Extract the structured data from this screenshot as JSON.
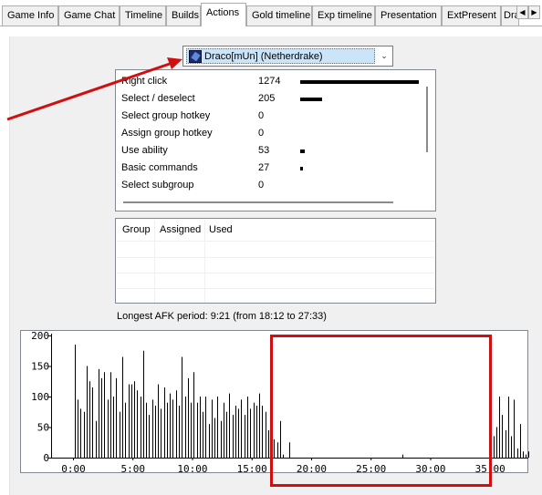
{
  "tabs": [
    {
      "label": "Game Info"
    },
    {
      "label": "Game Chat"
    },
    {
      "label": "Timeline"
    },
    {
      "label": "Builds"
    },
    {
      "label": "Actions"
    },
    {
      "label": "Gold timeline"
    },
    {
      "label": "Exp timeline"
    },
    {
      "label": "Presentation"
    },
    {
      "label": "ExtPresent"
    },
    {
      "label": "Dra"
    }
  ],
  "active_tab": "Actions",
  "player_select": {
    "value": "Draco[mUn] (Netherdrake)",
    "icon": "netherdrake-hero-icon"
  },
  "actions": [
    {
      "name": "Right click",
      "count": "1274"
    },
    {
      "name": "Select / deselect",
      "count": "205"
    },
    {
      "name": "Select group hotkey",
      "count": "0"
    },
    {
      "name": "Assign group hotkey",
      "count": "0"
    },
    {
      "name": "Use ability",
      "count": "53"
    },
    {
      "name": "Basic commands",
      "count": "27"
    },
    {
      "name": "Select subgroup",
      "count": "0"
    }
  ],
  "groups_table": {
    "columns": [
      "Group",
      "Assigned",
      "Used"
    ],
    "rows": []
  },
  "afk_text": "Longest AFK period: 9:21 (from 18:12 to 27:33)",
  "chart_data": {
    "type": "bar",
    "y_ticks": [
      "200",
      "150",
      "100",
      "50",
      "0"
    ],
    "x_ticks": [
      "0:00",
      "5:00",
      "10:00",
      "15:00",
      "20:00",
      "25:00",
      "30:00",
      "35:00"
    ],
    "ylim": [
      0,
      200
    ],
    "xlim_minutes": [
      -1.8,
      38.2
    ],
    "bar_color": "#000000",
    "highlight_color": "#d01010",
    "arrow_color": "#d01010",
    "values": [
      [
        0.1,
        185
      ],
      [
        0.35,
        95
      ],
      [
        0.6,
        80
      ],
      [
        0.85,
        75
      ],
      [
        1.1,
        150
      ],
      [
        1.35,
        125
      ],
      [
        1.6,
        115
      ],
      [
        1.85,
        60
      ],
      [
        2.1,
        145
      ],
      [
        2.35,
        130
      ],
      [
        2.6,
        140
      ],
      [
        2.85,
        95
      ],
      [
        3.1,
        140
      ],
      [
        3.35,
        100
      ],
      [
        3.6,
        130
      ],
      [
        3.85,
        75
      ],
      [
        4.1,
        165
      ],
      [
        4.35,
        90
      ],
      [
        4.6,
        120
      ],
      [
        4.85,
        120
      ],
      [
        5.1,
        125
      ],
      [
        5.35,
        110
      ],
      [
        5.6,
        100
      ],
      [
        5.85,
        175
      ],
      [
        6.1,
        90
      ],
      [
        6.35,
        70
      ],
      [
        6.6,
        95
      ],
      [
        6.85,
        85
      ],
      [
        7.1,
        120
      ],
      [
        7.35,
        80
      ],
      [
        7.6,
        115
      ],
      [
        7.85,
        90
      ],
      [
        8.1,
        105
      ],
      [
        8.35,
        95
      ],
      [
        8.6,
        110
      ],
      [
        8.85,
        85
      ],
      [
        9.1,
        165
      ],
      [
        9.35,
        100
      ],
      [
        9.6,
        130
      ],
      [
        9.85,
        90
      ],
      [
        10.1,
        140
      ],
      [
        10.35,
        90
      ],
      [
        10.6,
        100
      ],
      [
        10.85,
        75
      ],
      [
        11.1,
        100
      ],
      [
        11.35,
        55
      ],
      [
        11.6,
        95
      ],
      [
        11.85,
        65
      ],
      [
        12.1,
        100
      ],
      [
        12.35,
        60
      ],
      [
        12.6,
        90
      ],
      [
        12.85,
        75
      ],
      [
        13.1,
        105
      ],
      [
        13.35,
        70
      ],
      [
        13.6,
        85
      ],
      [
        13.85,
        80
      ],
      [
        14.1,
        95
      ],
      [
        14.35,
        70
      ],
      [
        14.6,
        100
      ],
      [
        14.85,
        80
      ],
      [
        15.1,
        90
      ],
      [
        15.35,
        85
      ],
      [
        15.6,
        105
      ],
      [
        15.85,
        85
      ],
      [
        16.1,
        75
      ],
      [
        16.35,
        45
      ],
      [
        16.6,
        55
      ],
      [
        16.85,
        30
      ],
      [
        17.1,
        25
      ],
      [
        17.35,
        60
      ],
      [
        17.6,
        5
      ],
      [
        18.1,
        25
      ],
      [
        27.6,
        5
      ],
      [
        35.0,
        25
      ],
      [
        35.25,
        35
      ],
      [
        35.5,
        50
      ],
      [
        35.75,
        100
      ],
      [
        36.0,
        70
      ],
      [
        36.25,
        45
      ],
      [
        36.5,
        100
      ],
      [
        36.75,
        35
      ],
      [
        37.0,
        95
      ],
      [
        37.25,
        15
      ],
      [
        37.5,
        55
      ],
      [
        37.75,
        10
      ],
      [
        38.0,
        5
      ],
      [
        38.2,
        10
      ],
      [
        38.4,
        5
      ],
      [
        38.55,
        15
      ],
      [
        38.8,
        5
      ],
      [
        39.2,
        8
      ]
    ]
  }
}
